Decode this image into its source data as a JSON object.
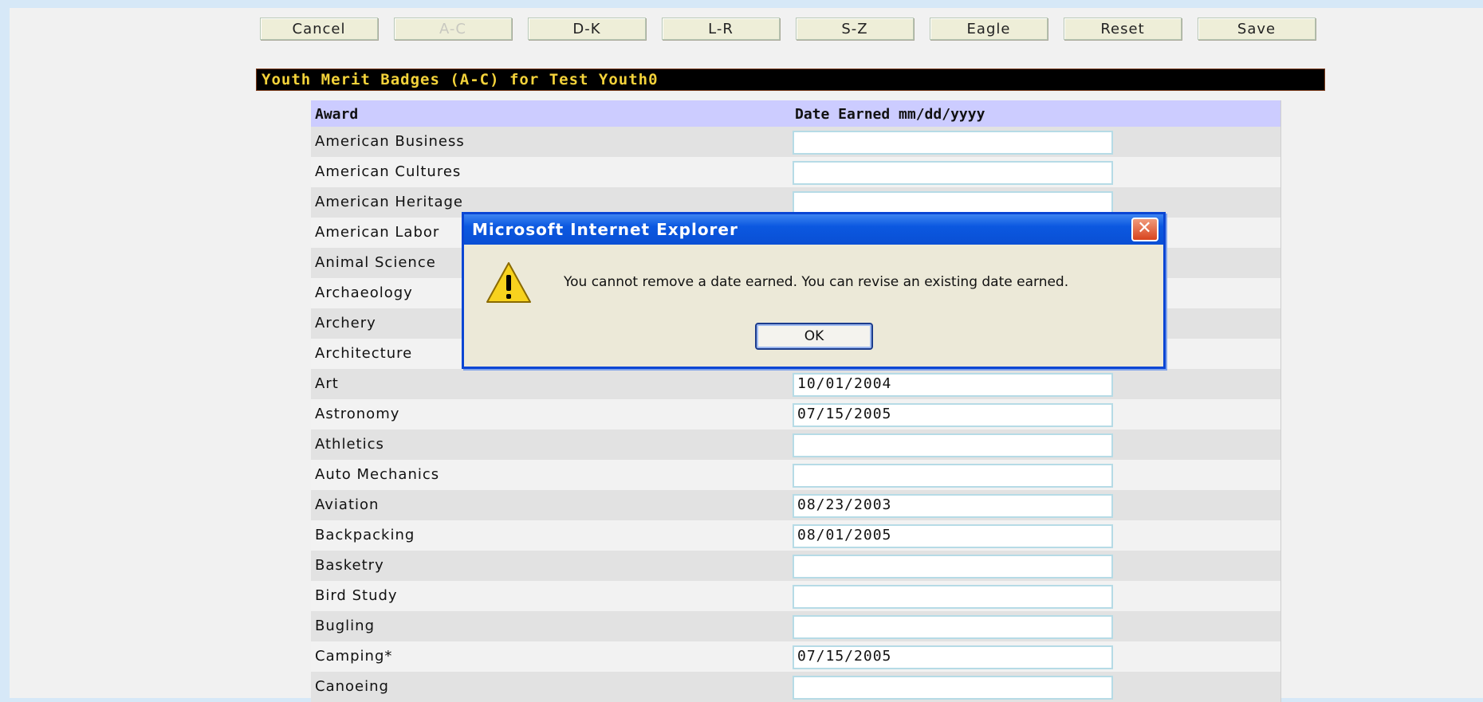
{
  "toolbar": {
    "buttons": [
      "Cancel",
      "A-C",
      "D-K",
      "L-R",
      "S-Z",
      "Eagle",
      "Reset",
      "Save"
    ]
  },
  "section_title": "Youth Merit Badges (A-C) for Test Youth0",
  "grid": {
    "headers": {
      "award": "Award",
      "date": "Date Earned mm/dd/yyyy"
    },
    "rows": [
      {
        "award": "American Business",
        "date": ""
      },
      {
        "award": "American Cultures",
        "date": ""
      },
      {
        "award": "American Heritage",
        "date": ""
      },
      {
        "award": "American Labor",
        "date": ""
      },
      {
        "award": "Animal Science",
        "date": ""
      },
      {
        "award": "Archaeology",
        "date": ""
      },
      {
        "award": "Archery",
        "date": ""
      },
      {
        "award": "Architecture",
        "date": ""
      },
      {
        "award": "Art",
        "date": "10/01/2004"
      },
      {
        "award": "Astronomy",
        "date": "07/15/2005"
      },
      {
        "award": "Athletics",
        "date": ""
      },
      {
        "award": "Auto Mechanics",
        "date": ""
      },
      {
        "award": "Aviation",
        "date": "08/23/2003"
      },
      {
        "award": "Backpacking",
        "date": "08/01/2005"
      },
      {
        "award": "Basketry",
        "date": ""
      },
      {
        "award": "Bird Study",
        "date": ""
      },
      {
        "award": "Bugling",
        "date": ""
      },
      {
        "award": "Camping*",
        "date": "07/15/2005"
      },
      {
        "award": "Canoeing",
        "date": ""
      }
    ]
  },
  "dialog": {
    "title": "Microsoft Internet Explorer",
    "message": "You cannot remove a date earned.  You can revise an existing date earned.",
    "ok_label": "OK",
    "close_glyph": "✕",
    "icon": "warning-icon"
  }
}
